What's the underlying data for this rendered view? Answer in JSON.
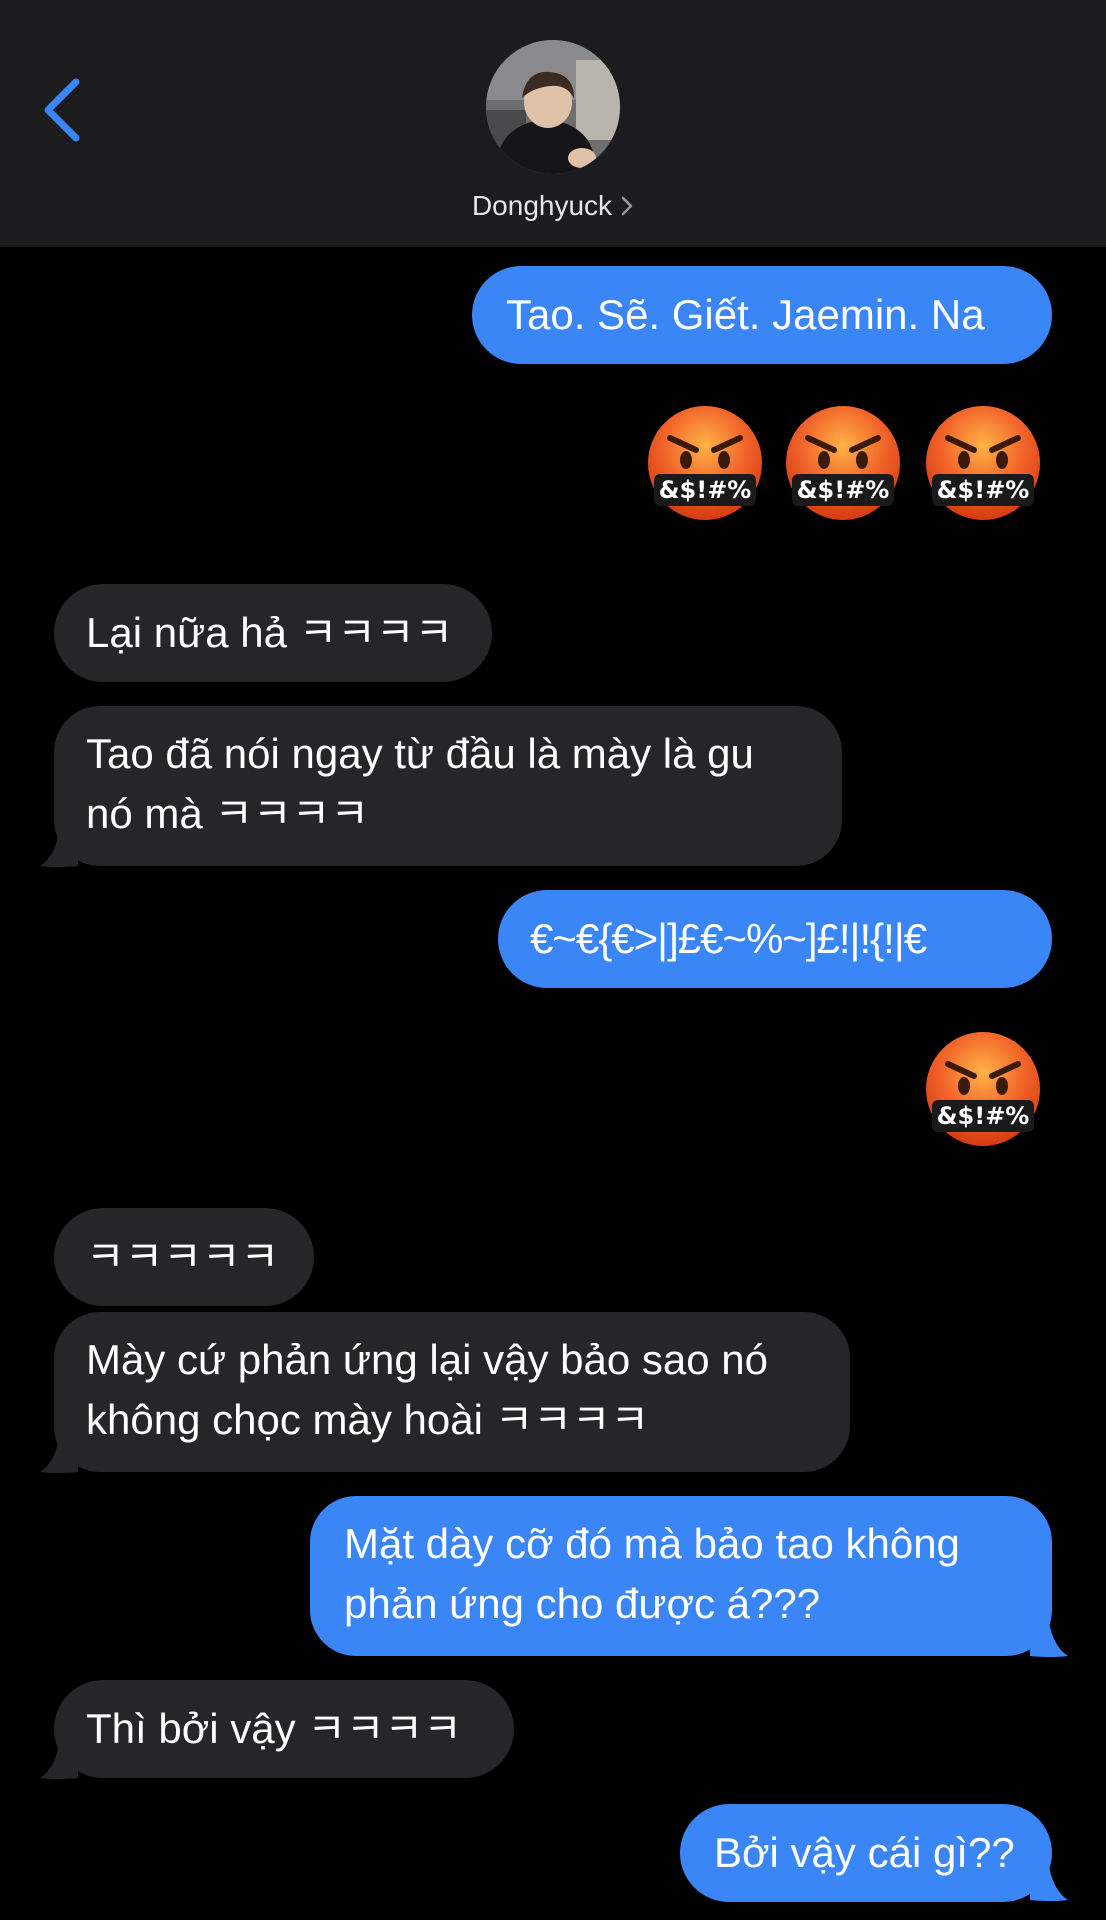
{
  "header": {
    "contact_name": "Donghyuck",
    "back_icon": "chevron-left-icon",
    "name_chevron_icon": "chevron-right-icon"
  },
  "colors": {
    "outgoing_bubble": "#3a86f7",
    "incoming_bubble": "#262629",
    "header_bg": "#1c1c1e",
    "accent": "#3a86f7"
  },
  "emoji_caption": "&$!#%",
  "messages": [
    {
      "direction": "outgoing",
      "text": "Tao. Sẽ. Giết. Jaemin. Na"
    },
    {
      "direction": "outgoing",
      "emoji": "face-with-symbols-on-mouth",
      "count": 3
    },
    {
      "direction": "incoming",
      "text": "Lại nữa hả ㅋㅋㅋㅋ"
    },
    {
      "direction": "incoming",
      "lines": [
        "Tao đã nói ngay từ đầu là mày là gu",
        "nó mà ㅋㅋㅋㅋ"
      ]
    },
    {
      "direction": "outgoing",
      "text": "€~€{€>|]£€~%~]£!|!{!|€"
    },
    {
      "direction": "outgoing",
      "emoji": "face-with-symbols-on-mouth",
      "count": 1
    },
    {
      "direction": "incoming",
      "text": "ㅋㅋㅋㅋㅋ"
    },
    {
      "direction": "incoming",
      "lines": [
        "Mày cứ phản ứng lại vậy bảo sao nó",
        "không chọc mày hoài ㅋㅋㅋㅋ"
      ]
    },
    {
      "direction": "outgoing",
      "lines": [
        "Mặt dày cỡ đó mà bảo tao không",
        "phản ứng cho được á???"
      ]
    },
    {
      "direction": "incoming",
      "text": "Thì bởi vậy ㅋㅋㅋㅋ"
    },
    {
      "direction": "outgoing",
      "text": "Bởi vậy cái gì??"
    }
  ]
}
